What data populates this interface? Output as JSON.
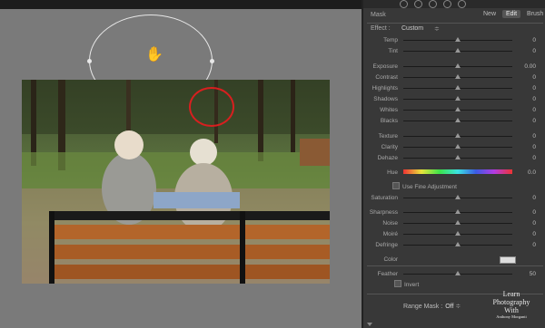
{
  "panel": {
    "mask_label": "Mask",
    "mask_buttons": [
      "New",
      "Edit",
      "Brush"
    ],
    "effect_label": "Effect :",
    "effect_value": "Custom",
    "effect_arrow": "≑",
    "sliders": [
      {
        "label": "Temp",
        "value": "0",
        "pos": 0.5
      },
      {
        "label": "Tint",
        "value": "0",
        "pos": 0.5
      },
      {
        "label": "Exposure",
        "value": "0.00",
        "pos": 0.5
      },
      {
        "label": "Contrast",
        "value": "0",
        "pos": 0.5
      },
      {
        "label": "Highlights",
        "value": "0",
        "pos": 0.5
      },
      {
        "label": "Shadows",
        "value": "0",
        "pos": 0.5
      },
      {
        "label": "Whites",
        "value": "0",
        "pos": 0.5
      },
      {
        "label": "Blacks",
        "value": "0",
        "pos": 0.5
      },
      {
        "label": "Texture",
        "value": "0",
        "pos": 0.5
      },
      {
        "label": "Clarity",
        "value": "0",
        "pos": 0.5
      },
      {
        "label": "Dehaze",
        "value": "0",
        "pos": 0.5
      }
    ],
    "hue": {
      "label": "Hue",
      "value": "0.0"
    },
    "fine_adjust_label": "Use Fine Adjustment",
    "sliders2": [
      {
        "label": "Saturation",
        "value": "0",
        "pos": 0.5
      },
      {
        "label": "Sharpness",
        "value": "0",
        "pos": 0.5
      },
      {
        "label": "Noise",
        "value": "0",
        "pos": 0.5
      },
      {
        "label": "Moiré",
        "value": "0",
        "pos": 0.5
      },
      {
        "label": "Defringe",
        "value": "0",
        "pos": 0.5
      }
    ],
    "color_label": "Color",
    "feather": {
      "label": "Feather",
      "value": "50",
      "pos": 0.5
    },
    "invert_label": "Invert",
    "range_mask_label": "Range Mask :",
    "range_mask_value": "Off",
    "range_mask_arrow": "≑"
  },
  "watermark": {
    "line1": "Learn",
    "line2": "Photography",
    "line3": "With",
    "line4": "Anthony Morganti"
  }
}
